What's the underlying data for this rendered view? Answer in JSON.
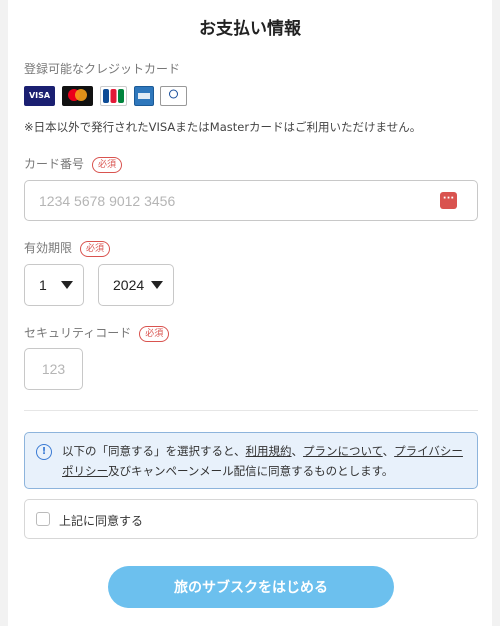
{
  "header": {
    "title": "お支払い情報"
  },
  "accepted_cards": {
    "label": "登録可能なクレジットカード",
    "brands": [
      "VISA",
      "Mastercard",
      "JCB",
      "AMEX",
      "Diners Club"
    ],
    "note": "※日本以外で発行されたVISAまたはMasterカードはご利用いただけません。"
  },
  "card_number": {
    "label": "カード番号",
    "required": "必須",
    "placeholder": "1234 5678 9012 3456",
    "value": ""
  },
  "expiry": {
    "label": "有効期限",
    "required": "必須",
    "month": "1",
    "year": "2024"
  },
  "security_code": {
    "label": "セキュリティコード",
    "required": "必須",
    "placeholder": "123",
    "value": ""
  },
  "info": {
    "prefix": "以下の「同意する」を選択すると、",
    "link_terms": "利用規約",
    "sep1": "、",
    "link_plan": "プランについて",
    "sep2": "、",
    "link_privacy": "プライバシーポリシー",
    "suffix": "及びキャンペーンメール配信に同意するものとします。"
  },
  "agreement": {
    "label": "上記に同意する",
    "checked": false
  },
  "submit": {
    "label": "旅のサブスクをはじめる"
  },
  "colors": {
    "accent": "#6cc0ee",
    "required": "#d9534f",
    "info_bg": "#e8f1fb",
    "info_border": "#8db4dc"
  }
}
